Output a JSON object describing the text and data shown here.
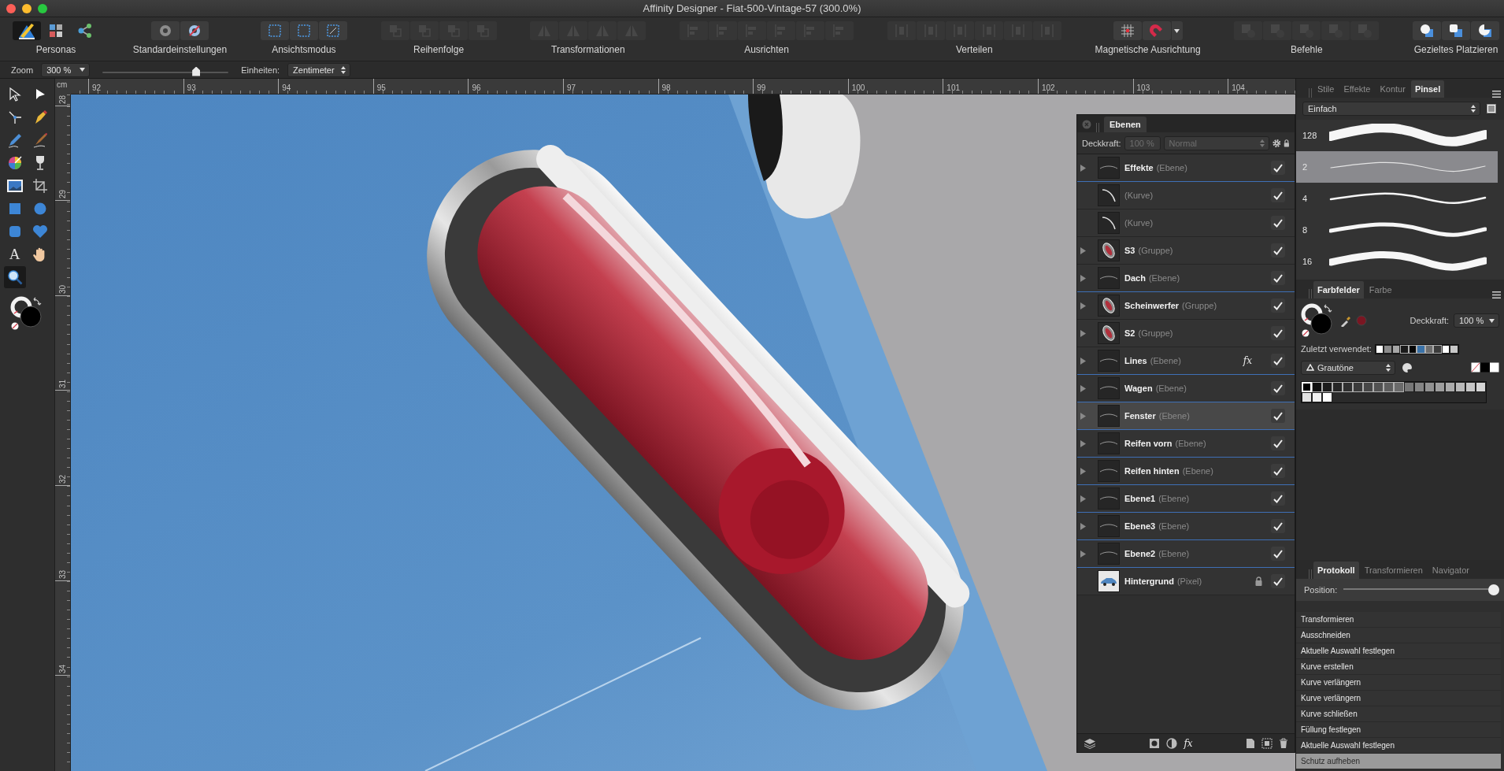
{
  "window": {
    "title": "Affinity Designer - Fiat-500-Vintage-57 (300.0%)"
  },
  "toolbar": {
    "groups": [
      {
        "label": "Personas",
        "disabled": false,
        "buttons": [
          {
            "selected": true,
            "disabled": false
          },
          {
            "selected": false,
            "disabled": false
          },
          {
            "selected": false,
            "disabled": false
          }
        ]
      },
      {
        "label": "Standardeinstellungen",
        "disabled": false,
        "buttons": [
          {
            "disabled": false
          },
          {
            "disabled": false
          }
        ]
      },
      {
        "label": "Ansichtsmodus",
        "disabled": false,
        "buttons": [
          {
            "disabled": false
          },
          {
            "disabled": false
          },
          {
            "disabled": false
          }
        ]
      },
      {
        "label": "Reihenfolge",
        "disabled": false,
        "buttons": [
          {
            "disabled": true
          },
          {
            "disabled": true
          },
          {
            "disabled": true
          },
          {
            "disabled": true
          }
        ]
      },
      {
        "label": "Transformationen",
        "disabled": false,
        "buttons": [
          {
            "disabled": true
          },
          {
            "disabled": true
          },
          {
            "disabled": true
          },
          {
            "disabled": true
          }
        ]
      },
      {
        "label": "Ausrichten",
        "disabled": false,
        "buttons": [
          {
            "disabled": true
          },
          {
            "disabled": true
          },
          {
            "disabled": true
          },
          {
            "disabled": true
          },
          {
            "disabled": true
          },
          {
            "disabled": true
          }
        ]
      },
      {
        "label": "Verteilen",
        "disabled": false,
        "buttons": [
          {
            "disabled": true
          },
          {
            "disabled": true
          },
          {
            "disabled": true
          },
          {
            "disabled": true
          },
          {
            "disabled": true
          },
          {
            "disabled": true
          }
        ]
      },
      {
        "label": "Magnetische Ausrichtung",
        "disabled": false,
        "buttons": [
          {
            "disabled": false,
            "menu": false
          },
          {
            "disabled": false,
            "menu": true
          }
        ]
      },
      {
        "label": "Befehle",
        "disabled": false,
        "buttons": [
          {
            "disabled": true
          },
          {
            "disabled": true
          },
          {
            "disabled": true
          },
          {
            "disabled": true
          },
          {
            "disabled": true
          }
        ]
      },
      {
        "label": "Gezieltes Platzieren",
        "disabled": false,
        "buttons": [
          {
            "disabled": false
          },
          {
            "disabled": false
          },
          {
            "disabled": false
          }
        ]
      }
    ]
  },
  "context_bar": {
    "zoom_label": "Zoom",
    "zoom_value": "300 %",
    "zoom_slider": {
      "level": 0.76
    },
    "units_label": "Einheiten:",
    "units_value": "Zentimeter"
  },
  "tools": [
    {
      "selected": false
    },
    {
      "selected": false
    },
    {
      "selected": false
    },
    {
      "selected": false
    },
    {
      "selected": false
    },
    {
      "selected": false
    },
    {
      "selected": false
    },
    {
      "selected": false
    },
    {
      "selected": false
    },
    {
      "selected": false
    },
    {
      "selected": false
    },
    {
      "selected": false
    },
    {
      "selected": false
    },
    {
      "selected": false
    },
    {
      "selected": false,
      "glyph": "A"
    },
    {
      "selected": false
    },
    {
      "selected": true
    }
  ],
  "rulers": {
    "unit": "cm",
    "horizontal": [
      "92",
      "93",
      "94",
      "95",
      "96",
      "97",
      "98",
      "99",
      "100",
      "101",
      "102",
      "103",
      "104"
    ],
    "vertical": [
      "28",
      "29",
      "30",
      "31",
      "32",
      "33",
      "34"
    ]
  },
  "layers": {
    "tab": "Ebenen",
    "opacity_label": "Deckkraft:",
    "opacity": {
      "value": "100 %",
      "disabled": true
    },
    "blend_mode": {
      "value": "Normal",
      "disabled": true
    },
    "rows": [
      {
        "name": "Effekte",
        "type": "(Ebene)",
        "kind": "layer",
        "expandable": true,
        "locked": false,
        "visible": true,
        "selected": false
      },
      {
        "type": "(Kurve)",
        "kind": "curve",
        "expandable": false,
        "locked": false,
        "visible": true,
        "selected": false
      },
      {
        "type": "(Kurve)",
        "kind": "curve",
        "expandable": false,
        "locked": false,
        "visible": true,
        "selected": false
      },
      {
        "name": "S3",
        "type": "(Gruppe)",
        "kind": "group",
        "expandable": true,
        "locked": false,
        "visible": true,
        "selected": false
      },
      {
        "name": "Dach",
        "type": "(Ebene)",
        "kind": "layer",
        "expandable": true,
        "locked": false,
        "visible": true,
        "selected": false
      },
      {
        "name": "Scheinwerfer",
        "type": "(Gruppe)",
        "kind": "group",
        "expandable": true,
        "locked": false,
        "visible": true,
        "selected": false
      },
      {
        "name": "S2",
        "type": "(Gruppe)",
        "kind": "group",
        "expandable": true,
        "locked": false,
        "visible": true,
        "selected": false
      },
      {
        "name": "Lines",
        "type": "(Ebene)",
        "kind": "layer",
        "expandable": true,
        "locked": false,
        "visible": true,
        "selected": false,
        "fx": "fx"
      },
      {
        "name": "Wagen",
        "type": "(Ebene)",
        "kind": "layer",
        "expandable": true,
        "locked": false,
        "visible": true,
        "selected": false
      },
      {
        "name": "Fenster",
        "type": "(Ebene)",
        "kind": "layer",
        "expandable": true,
        "locked": false,
        "visible": true,
        "selected": true
      },
      {
        "name": "Reifen vorn",
        "type": "(Ebene)",
        "kind": "layer",
        "expandable": true,
        "locked": false,
        "visible": true,
        "selected": false
      },
      {
        "name": "Reifen hinten",
        "type": "(Ebene)",
        "kind": "layer",
        "expandable": true,
        "locked": false,
        "visible": true,
        "selected": false
      },
      {
        "name": "Ebene1",
        "type": "(Ebene)",
        "kind": "layer",
        "expandable": true,
        "locked": false,
        "visible": true,
        "selected": false
      },
      {
        "name": "Ebene3",
        "type": "(Ebene)",
        "kind": "layer",
        "expandable": true,
        "locked": false,
        "visible": true,
        "selected": false
      },
      {
        "name": "Ebene2",
        "type": "(Ebene)",
        "kind": "layer",
        "expandable": true,
        "locked": false,
        "visible": true,
        "selected": false
      },
      {
        "name": "Hintergrund",
        "type": "(Pixel)",
        "kind": "pixel",
        "expandable": false,
        "locked": true,
        "visible": true,
        "selected": false
      }
    ],
    "footer_fx": "fx"
  },
  "brushes": {
    "tabs": [
      {
        "label": "Stile",
        "selected": false
      },
      {
        "label": "Effekte",
        "selected": false
      },
      {
        "label": "Kontur",
        "selected": false
      },
      {
        "label": "Pinsel",
        "selected": true
      }
    ],
    "category": "Einfach",
    "items": [
      {
        "size": "128",
        "selected": false
      },
      {
        "size": "2",
        "selected": true
      },
      {
        "size": "4",
        "selected": false
      },
      {
        "size": "8",
        "selected": false
      },
      {
        "size": "16",
        "selected": false
      }
    ]
  },
  "swatches": {
    "tabs": [
      {
        "label": "Farbfelder",
        "selected": true
      },
      {
        "label": "Farbe",
        "selected": false
      }
    ],
    "opacity_label": "Deckkraft:",
    "opacity_value": "100 %",
    "recent_label": "Zuletzt verwendet:",
    "recent": [
      {
        "color": "#ffffff"
      },
      {
        "color": "#8c8c8c"
      },
      {
        "color": "#a6a6a6"
      },
      {
        "color": "#1a1a1a"
      },
      {
        "color": "#050505"
      },
      {
        "color": "#3a72a8"
      },
      {
        "color": "#6e6e6e"
      },
      {
        "color": "#3c3c3c"
      },
      {
        "color": "#ffffff"
      },
      {
        "color": "#c8c8c8"
      }
    ],
    "palette": "Grautöne",
    "colors": [
      {
        "color": "#000000",
        "selected": true
      },
      {
        "color": "#0f0f0f",
        "selected": false
      },
      {
        "color": "#1c1c1c",
        "selected": false
      },
      {
        "color": "#262626",
        "selected": false
      },
      {
        "color": "#303030",
        "selected": false
      },
      {
        "color": "#3b3b3b",
        "selected": false
      },
      {
        "color": "#474747",
        "selected": false
      },
      {
        "color": "#525252",
        "selected": false
      },
      {
        "color": "#5e5e5e",
        "selected": false
      },
      {
        "color": "#6b6b6b",
        "selected": false
      },
      {
        "color": "#777777",
        "selected": false
      },
      {
        "color": "#848484",
        "selected": false
      },
      {
        "color": "#919191",
        "selected": false
      },
      {
        "color": "#9e9e9e",
        "selected": false
      },
      {
        "color": "#ababab",
        "selected": false
      },
      {
        "color": "#b9b9b9",
        "selected": false
      },
      {
        "color": "#c6c6c6",
        "selected": false
      },
      {
        "color": "#d4d4d4",
        "selected": false
      },
      {
        "color": "#e2e2e2",
        "selected": false
      },
      {
        "color": "#f0f0f0",
        "selected": false
      },
      {
        "color": "#ffffff",
        "selected": false
      }
    ]
  },
  "history": {
    "tabs": [
      {
        "label": "Protokoll",
        "selected": true
      },
      {
        "label": "Transformieren",
        "selected": false
      },
      {
        "label": "Navigator",
        "selected": false
      }
    ],
    "position_label": "Position:",
    "position": {
      "level": 1
    },
    "items": [
      {
        "label": "Transformieren",
        "selected": false
      },
      {
        "label": "Ausschneiden",
        "selected": false
      },
      {
        "label": "Aktuelle Auswahl festlegen",
        "selected": false
      },
      {
        "label": "Kurve erstellen",
        "selected": false
      },
      {
        "label": "Kurve verlängern",
        "selected": false
      },
      {
        "label": "Kurve verlängern",
        "selected": false
      },
      {
        "label": "Kurve schließen",
        "selected": false
      },
      {
        "label": "Füllung festlegen",
        "selected": false
      },
      {
        "label": "Aktuelle Auswahl festlegen",
        "selected": false
      },
      {
        "label": "Schutz aufheben",
        "selected": true
      }
    ]
  }
}
